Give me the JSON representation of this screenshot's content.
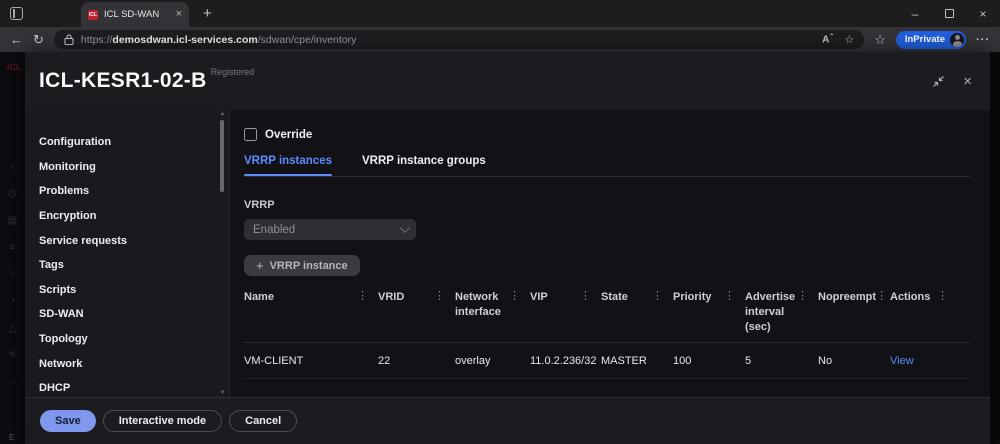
{
  "browser": {
    "tab_title": "ICL SD-WAN",
    "url_scheme": "https://",
    "url_host": "demosdwan.icl-services.com",
    "url_path": "/sdwan/cpe/inventory",
    "inprivate_label": "InPrivate"
  },
  "background": {
    "logo": "iCL",
    "bottom_letter": "E"
  },
  "modal": {
    "title": "ICL-KESR1-02-B",
    "status_badge": "Registered",
    "sidebar_items": [
      "Configuration",
      "Monitoring",
      "Problems",
      "Encryption",
      "Service requests",
      "Tags",
      "Scripts",
      "SD-WAN",
      "Topology",
      "Network",
      "DHCP"
    ],
    "override_label": "Override",
    "tabs": {
      "active": "VRRP instances",
      "inactive": "VRRP instance groups"
    },
    "vrrp_label": "VRRP",
    "vrrp_value": "Enabled",
    "add_instance_label": "VRRP instance",
    "table": {
      "columns": [
        "Name",
        "VRID",
        "Network interface",
        "VIP",
        "State",
        "Priority",
        "Advertise interval (sec)",
        "Nopreempt",
        "Actions"
      ],
      "row": {
        "name": "VM-CLIENT",
        "vrid": "22",
        "network_interface": "overlay",
        "vip": "11.0.2.236/32",
        "state": "MASTER",
        "priority": "100",
        "advertise_interval": "5",
        "nopreempt": "No",
        "action": "View"
      }
    },
    "footer": {
      "save": "Save",
      "interactive_mode": "Interactive mode",
      "cancel": "Cancel"
    }
  },
  "icons": {
    "favicon_text": "ICL",
    "close": "×",
    "plus": "+",
    "kebab": "⋮",
    "back": "←",
    "refresh": "↻",
    "minimize": "–",
    "more": "···",
    "star": "☆",
    "read_aloud": "A",
    "new_tab": "+",
    "scroll_up": "▲",
    "scroll_down": "▼"
  },
  "colors": {
    "accent_blue": "#5b8cff",
    "save_button": "#8097ee",
    "inprivate_blue": "#2160df",
    "favicon_red": "#c4212e"
  }
}
